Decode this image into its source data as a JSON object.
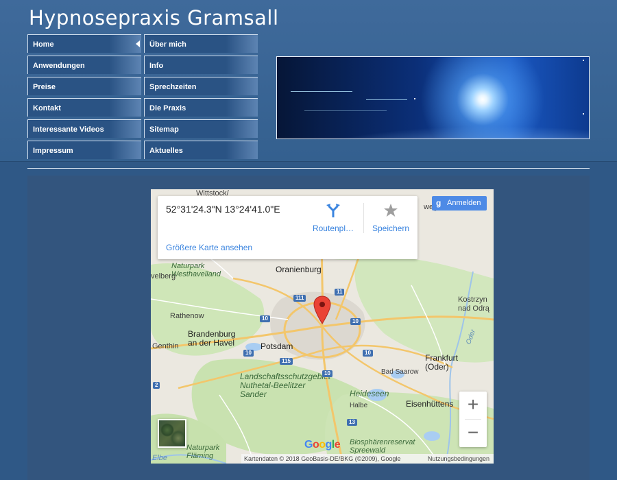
{
  "site": {
    "title": "Hypnosepraxis Gramsall"
  },
  "nav": {
    "col1": [
      "Home",
      "Anwendungen",
      "Preise",
      "Kontakt",
      "Interessante Videos",
      "Impressum"
    ],
    "col2": [
      "Über mich",
      "Info",
      "Sprechzeiten",
      "Die Praxis",
      "Sitemap",
      "Aktuelles"
    ],
    "active": "Home"
  },
  "map": {
    "coords": "52°31'24.3\"N 13°24'41.0\"E",
    "larger_map_link": "Größere Karte ansehen",
    "directions_label": "Routenpl…",
    "save_label": "Speichern",
    "signin_label": "Anmelden",
    "zoom_in": "+",
    "zoom_out": "−",
    "google_logo": "Google",
    "attribution": "Kartendaten © 2018 GeoBasis-DE/BKG (©2009), Google",
    "terms": "Nutzungsbedingungen",
    "places": {
      "wittstock": "Wittstock/",
      "oranienburg": "Oranienburg",
      "naturpark_westhavelland": "Naturpark\nWesthavelland",
      "rathenow": "Rathenow",
      "brandenburg": "Brandenburg\nan der Havel",
      "genthin": "Genthin",
      "potsdam": "Potsdam",
      "landschaftsschutzgebiet": "Landschaftsschutzgebiet\nNuthetal-Beelitzer\nSander",
      "heideseen": "Heideseen",
      "halbe": "Halbe",
      "bad_saarow": "Bad Saarow",
      "frankfurt": "Frankfurt\n(Oder)",
      "eisenhuettenstadt": "Eisenhüttens",
      "kostrzyn": "Kostrzyn\nnad Odrą",
      "biosphaere": "Biosphärenreservat\nSpreewald",
      "naturpark_flaeming": "Naturpark\nFläming",
      "elbe": "Elbe",
      "oder": "Oder",
      "velberg": "velberg",
      "weg": "weg"
    },
    "roads": [
      "111",
      "11",
      "10",
      "10",
      "10",
      "10",
      "115",
      "10",
      "2",
      "13"
    ]
  },
  "colors": {
    "header_bg": "#3f6a9b",
    "page_bg": "#2f5886",
    "link_blue": "#3a84df",
    "pin_red": "#ea4335"
  }
}
